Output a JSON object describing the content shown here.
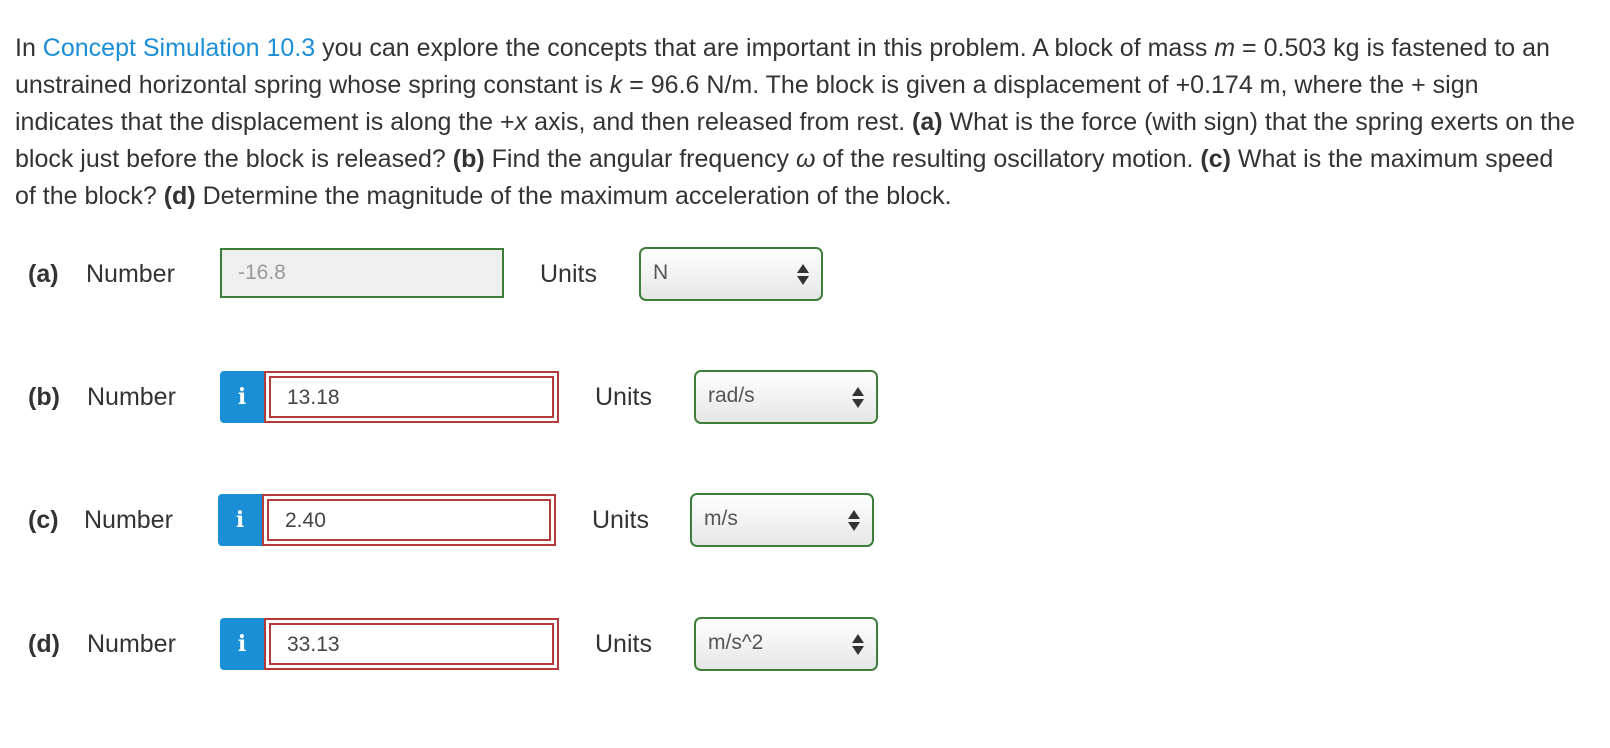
{
  "problem": {
    "intro": "In ",
    "link_text": "Concept Simulation 10.3",
    "t1": " you can explore the concepts that are important in this problem. A block of mass ",
    "m_var": "m",
    "t2": " = 0.503 kg is fastened to an unstrained horizontal spring whose spring constant is ",
    "k_var": "k",
    "t3": " = 96.6 N/m. The block is given a displacement of +0.174 m, where the + sign indicates that the displacement is along the +",
    "x_var": "x",
    "t4": " axis, and then released from rest. ",
    "pa": "(a)",
    "qa": " What is the force (with sign) that the spring exerts on the block just before the block is released? ",
    "pb": "(b)",
    "qb": " Find the angular frequency ",
    "omega": "ω",
    "qb2": " of the resulting oscillatory motion. ",
    "pc": "(c)",
    "qc": " What is the maximum speed of the block? ",
    "pd": "(d)",
    "qd": " Determine the magnitude of the maximum acceleration of the block."
  },
  "number_label": "Number",
  "units_label": "Units",
  "info_glyph": "i",
  "parts": [
    {
      "label": "(a)",
      "value": "-16.8",
      "units": "N",
      "has_info": false,
      "state": "correct"
    },
    {
      "label": "(b)",
      "value": "13.18",
      "units": "rad/s",
      "has_info": true,
      "state": "incorrect"
    },
    {
      "label": "(c)",
      "value": "2.40",
      "units": "m/s",
      "has_info": true,
      "state": "incorrect"
    },
    {
      "label": "(d)",
      "value": "33.13",
      "units": "m/s^2",
      "has_info": true,
      "state": "incorrect"
    }
  ],
  "colors": {
    "link": "#1a8fd6",
    "correct_border": "#3d7f3a",
    "incorrect_border": "#b53a3a",
    "info_badge": "#1a8fd6"
  }
}
